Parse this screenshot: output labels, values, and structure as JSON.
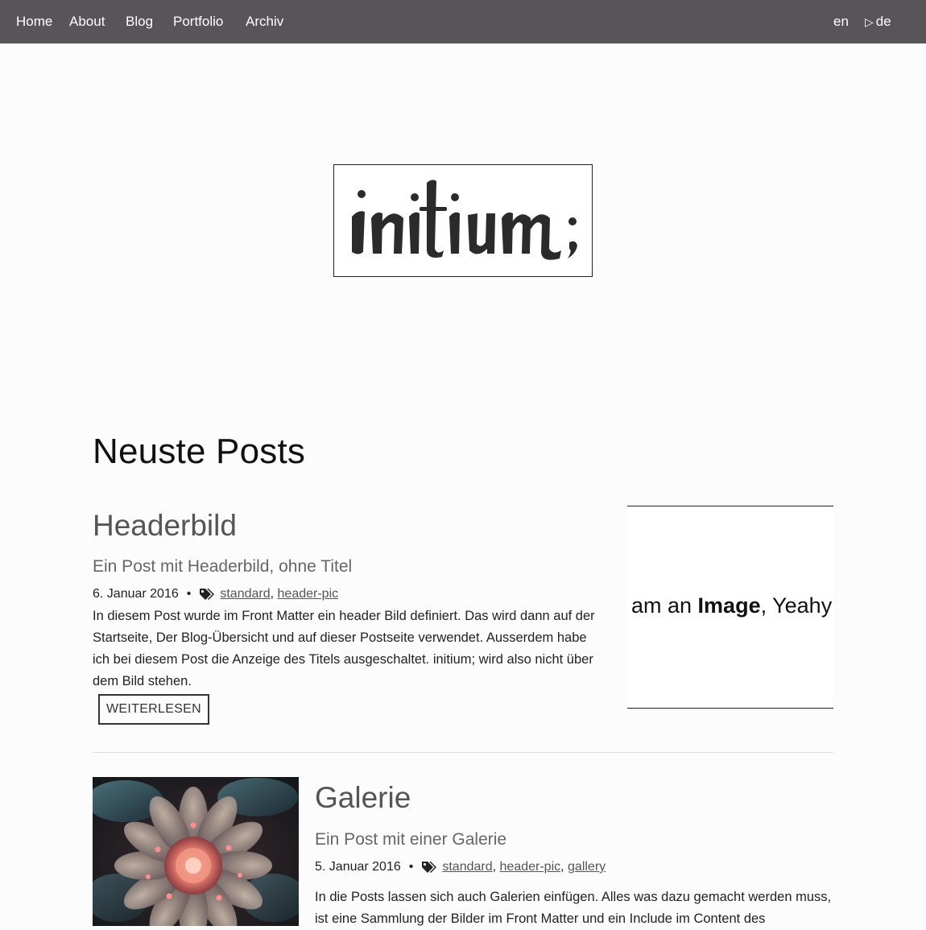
{
  "nav": {
    "items": [
      "Home",
      "About",
      "Blog",
      "Portfolio",
      "Archiv"
    ],
    "lang_en": "en",
    "lang_de_marker": "▷",
    "lang_de": "de"
  },
  "logo": {
    "text": "initium;"
  },
  "section": {
    "title": "Neuste Posts"
  },
  "posts": [
    {
      "title": "Headerbild",
      "subtitle": "Ein Post mit Headerbild, ohne Titel",
      "date": "6. Januar 2016",
      "separator": "•",
      "tags": [
        "standard",
        "header-pic"
      ],
      "excerpt": "In diesem Post wurde im Front Matter ein header Bild definiert. Das wird dann auf der Startseite, Der Blog-Übersicht und auf dieser Postseite verwendet. Ausserdem habe ich bei diesem Post die Anzeige des Titels ausgeschaltet. initium; wird also nicht über dem Bild stehen.",
      "read_more": "WEITERLESEN",
      "image_text": {
        "before": "am an ",
        "bold": "Image",
        "after": ", Yeahy"
      }
    },
    {
      "title": "Galerie",
      "subtitle": "Ein Post mit einer Galerie",
      "date": "5. Januar 2016",
      "separator": "•",
      "tags": [
        "standard",
        "header-pic",
        "gallery"
      ],
      "excerpt": "In die Posts lassen sich auch Galerien einfügen. Alles was dazu gemacht werden muss, ist eine Sammlung der Bilder im Front Matter und ein Include im Content des"
    }
  ],
  "icons": {
    "tag": "tags-icon",
    "flower": "fractal-flower-image"
  },
  "colors": {
    "nav_bg": "#585457",
    "page_bg": "#fcfcfc",
    "flower_center": "#e0766a"
  }
}
